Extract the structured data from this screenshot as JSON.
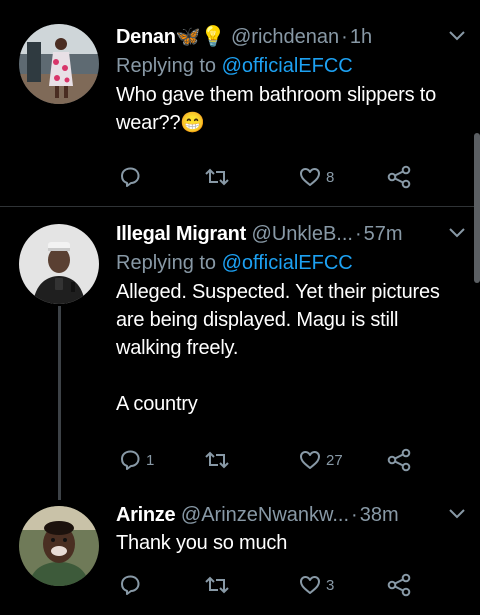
{
  "colors": {
    "background": "#000000",
    "text": "#ffffff",
    "muted": "#8899a6",
    "link": "#1da1f2",
    "divider": "#2f3336"
  },
  "tweets": [
    {
      "name": "Denan",
      "name_emojis": "🦋💡",
      "handle": "@richdenan",
      "time": "1h",
      "replying_label": "Replying to",
      "replying_to": "@officialEFCC",
      "text": "Who gave them bathroom slippers to wear??😁",
      "actions": {
        "reply_count": "",
        "retweet_count": "",
        "like_count": "8"
      },
      "icons": [
        "reply-icon",
        "retweet-icon",
        "like-icon",
        "share-icon"
      ]
    },
    {
      "name": "Illegal Migrant",
      "handle": "@UnkleB...",
      "time": "57m",
      "replying_label": "Replying to",
      "replying_to": "@officialEFCC",
      "text": "Alleged. Suspected. Yet their pictures are being displayed. Magu is still walking freely.\n\nA country",
      "actions": {
        "reply_count": "1",
        "retweet_count": "",
        "like_count": "27"
      },
      "icons": [
        "reply-icon",
        "retweet-icon",
        "like-icon",
        "share-icon"
      ]
    },
    {
      "name": "Arinze",
      "handle": "@ArinzeNwankw...",
      "time": "38m",
      "text": "Thank you so much",
      "actions": {
        "reply_count": "",
        "retweet_count": "",
        "like_count": "3"
      },
      "icons": [
        "reply-icon",
        "retweet-icon",
        "like-icon",
        "share-icon"
      ]
    }
  ]
}
